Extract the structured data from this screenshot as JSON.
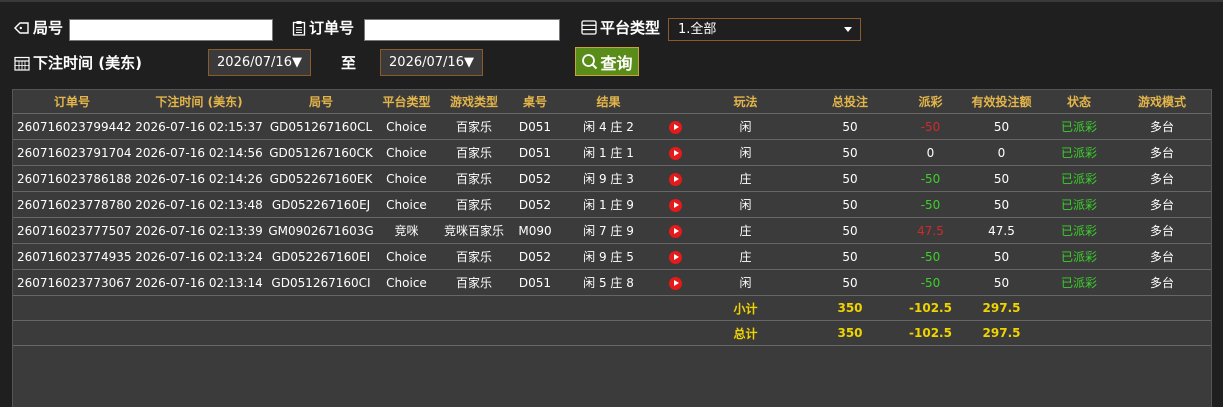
{
  "filters": {
    "round_label": "局号",
    "round_value": "",
    "order_label": "订单号",
    "order_value": "",
    "platform_label": "平台类型",
    "platform_selected": "1.全部",
    "bet_time_label": "下注时间 (美东)",
    "date_from": "2026/07/16▼",
    "to_label": "至",
    "date_to": "2026/07/16▼",
    "query_label": "查询"
  },
  "table": {
    "headers": [
      "订单号",
      "下注时间 (美东)",
      "局号",
      "平台类型",
      "游戏类型",
      "桌号",
      "结果",
      "",
      "玩法",
      "总投注",
      "派彩",
      "有效投注额",
      "状态",
      "游戏模式"
    ],
    "rows": [
      {
        "order": "260716023799442",
        "time": "2026-07-16 02:15:37",
        "round": "GD051267160CL",
        "platform": "Choice",
        "game": "百家乐",
        "table": "D051",
        "result": "闲 4 庄 2",
        "play": "闲",
        "bet": "50",
        "payout": "-50",
        "payout_color": "red",
        "valid": "50",
        "status": "已派彩",
        "mode": "多台"
      },
      {
        "order": "260716023791704",
        "time": "2026-07-16 02:14:56",
        "round": "GD051267160CK",
        "platform": "Choice",
        "game": "百家乐",
        "table": "D051",
        "result": "闲 1 庄 1",
        "play": "闲",
        "bet": "50",
        "payout": "0",
        "payout_color": "white",
        "valid": "0",
        "status": "已派彩",
        "mode": "多台"
      },
      {
        "order": "260716023786188",
        "time": "2026-07-16 02:14:26",
        "round": "GD052267160EK",
        "platform": "Choice",
        "game": "百家乐",
        "table": "D052",
        "result": "闲 9 庄 3",
        "play": "庄",
        "bet": "50",
        "payout": "-50",
        "payout_color": "green",
        "valid": "50",
        "status": "已派彩",
        "mode": "多台"
      },
      {
        "order": "260716023778780",
        "time": "2026-07-16 02:13:48",
        "round": "GD052267160EJ",
        "platform": "Choice",
        "game": "百家乐",
        "table": "D052",
        "result": "闲 1 庄 9",
        "play": "闲",
        "bet": "50",
        "payout": "-50",
        "payout_color": "green",
        "valid": "50",
        "status": "已派彩",
        "mode": "多台"
      },
      {
        "order": "260716023777507",
        "time": "2026-07-16 02:13:39",
        "round": "GM0902671603G",
        "platform": "竞咪",
        "game": "竞咪百家乐",
        "table": "M090",
        "result": "闲 7 庄 9",
        "play": "庄",
        "bet": "50",
        "payout": "47.5",
        "payout_color": "red",
        "valid": "47.5",
        "status": "已派彩",
        "mode": "多台"
      },
      {
        "order": "260716023774935",
        "time": "2026-07-16 02:13:24",
        "round": "GD052267160EI",
        "platform": "Choice",
        "game": "百家乐",
        "table": "D052",
        "result": "闲 9 庄 5",
        "play": "庄",
        "bet": "50",
        "payout": "-50",
        "payout_color": "green",
        "valid": "50",
        "status": "已派彩",
        "mode": "多台"
      },
      {
        "order": "260716023773067",
        "time": "2026-07-16 02:13:14",
        "round": "GD051267160CI",
        "platform": "Choice",
        "game": "百家乐",
        "table": "D051",
        "result": "闲 5 庄 8",
        "play": "闲",
        "bet": "50",
        "payout": "-50",
        "payout_color": "green",
        "valid": "50",
        "status": "已派彩",
        "mode": "多台"
      }
    ],
    "subtotal": {
      "label": "小计",
      "bet": "350",
      "payout": "-102.5",
      "valid": "297.5"
    },
    "total": {
      "label": "总计",
      "bet": "350",
      "payout": "-102.5",
      "valid": "297.5"
    }
  },
  "colors": {
    "header_text": "#e3b54a",
    "sum_text": "#f0d400",
    "status_green": "#3ad12a",
    "payout_red": "#d12a2a",
    "query_button": "#5a8c1a"
  }
}
